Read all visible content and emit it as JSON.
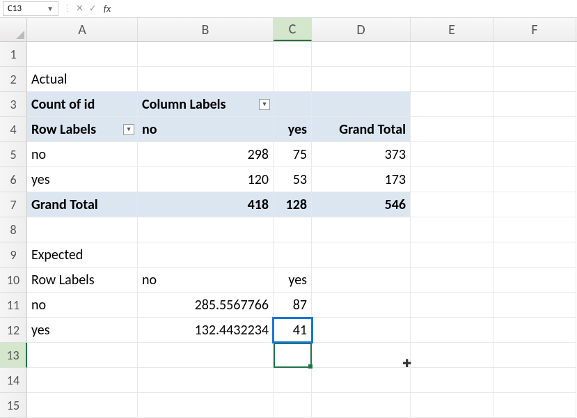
{
  "nameBox": "C13",
  "formulaBar": "",
  "columns": [
    "A",
    "B",
    "C",
    "D",
    "E",
    "F"
  ],
  "rows": [
    "1",
    "2",
    "3",
    "4",
    "5",
    "6",
    "7",
    "8",
    "9",
    "10",
    "11",
    "12",
    "13",
    "14",
    "15"
  ],
  "cells": {
    "A2": "Actual",
    "A3": "Count of id",
    "B3": "Column Labels",
    "A4": "Row Labels",
    "B4": "no",
    "C4": "yes",
    "D4": "Grand Total",
    "A5": "no",
    "B5": "298",
    "C5": "75",
    "D5": "373",
    "A6": "yes",
    "B6": "120",
    "C6": "53",
    "D6": "173",
    "A7": "Grand Total",
    "B7": "418",
    "C7": "128",
    "D7": "546",
    "A9": "Expected",
    "A10": "Row Labels",
    "B10": "no",
    "C10": "yes",
    "A11": "no",
    "B11": "285.5567766",
    "C11": "87",
    "A12": "yes",
    "B12": "132.4432234",
    "C12": "41"
  },
  "chart_data": [
    {
      "type": "table",
      "title": "Actual – Count of id",
      "row_labels": [
        "no",
        "yes",
        "Grand Total"
      ],
      "col_labels": [
        "no",
        "yes",
        "Grand Total"
      ],
      "values": [
        [
          298,
          75,
          373
        ],
        [
          120,
          53,
          173
        ],
        [
          418,
          128,
          546
        ]
      ]
    },
    {
      "type": "table",
      "title": "Expected",
      "row_labels": [
        "no",
        "yes"
      ],
      "col_labels": [
        "no",
        "yes"
      ],
      "values": [
        [
          285.5567766,
          87
        ],
        [
          132.4432234,
          41
        ]
      ]
    }
  ]
}
